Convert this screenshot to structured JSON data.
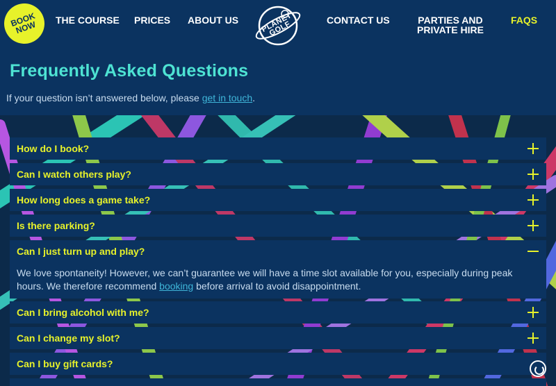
{
  "header": {
    "book_now": "BOOK\nNOW",
    "nav": [
      {
        "label": "THE COURSE"
      },
      {
        "label": "PRICES"
      },
      {
        "label": "ABOUT US"
      },
      {
        "label": "CONTACT US"
      },
      {
        "label": "PARTIES AND\nPRIVATE HIRE"
      },
      {
        "label": "FAQS"
      }
    ],
    "logo_text": "PLANET\nGOLF"
  },
  "intro": {
    "title": "Frequently Asked Questions",
    "text_before": "If your question isn’t answered below, please ",
    "link": "get in touch",
    "text_after": "."
  },
  "faqs": [
    {
      "question": "How do I book?",
      "state": "collapsed"
    },
    {
      "question": "Can I watch others play?",
      "state": "collapsed"
    },
    {
      "question": "How long does a game take?",
      "state": "collapsed"
    },
    {
      "question": "Is there parking?",
      "state": "collapsed"
    },
    {
      "question": "Can I just turn up and play?",
      "state": "expanded",
      "answer_before": "We love spontaneity! However, we can’t guarantee we will have a time slot available for you, especially during peak hours. We therefore recommend ",
      "answer_link": "booking",
      "answer_after": " before arrival to avoid disappointment."
    },
    {
      "question": "Can I bring alcohol with me?",
      "state": "collapsed"
    },
    {
      "question": "Can I change my slot?",
      "state": "collapsed"
    },
    {
      "question": "Can I buy gift cards?",
      "state": "collapsed"
    }
  ],
  "colors": {
    "navy": "#0b3360",
    "accent_yellow": "#e7f22a",
    "title_teal": "#4ee3d3",
    "link_blue": "#3fb6d9"
  },
  "icons": [
    "plus-icon",
    "minus-icon",
    "accessibility-icon"
  ]
}
